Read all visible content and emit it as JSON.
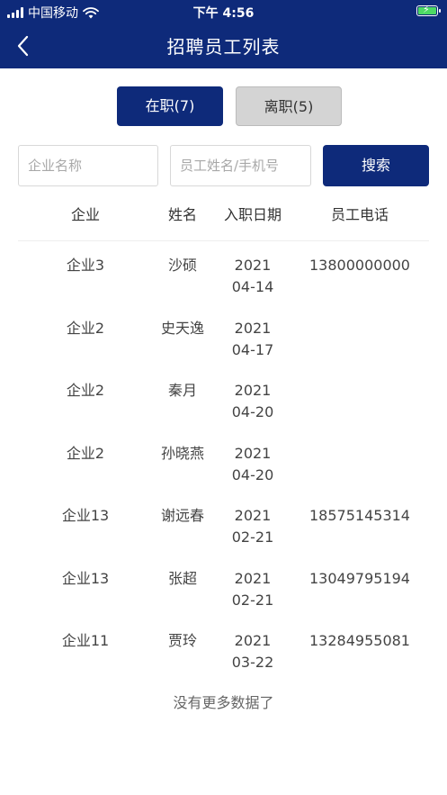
{
  "status_bar": {
    "carrier": "中国移动",
    "time": "下午 4:56"
  },
  "nav": {
    "title": "招聘员工列表"
  },
  "tabs": [
    {
      "label": "在职(7)",
      "active": true
    },
    {
      "label": "离职(5)",
      "active": false
    }
  ],
  "search": {
    "company_placeholder": "企业名称",
    "staff_placeholder": "员工姓名/手机号",
    "button_label": "搜索"
  },
  "table": {
    "headers": [
      "企业",
      "姓名",
      "入职日期",
      "员工电话"
    ],
    "rows": [
      {
        "company": "企业3",
        "name": "沙硕",
        "date_year": "2021",
        "date_md": "04-14",
        "phone": "13800000000"
      },
      {
        "company": "企业2",
        "name": "史天逸",
        "date_year": "2021",
        "date_md": "04-17",
        "phone": ""
      },
      {
        "company": "企业2",
        "name": "秦月",
        "date_year": "2021",
        "date_md": "04-20",
        "phone": ""
      },
      {
        "company": "企业2",
        "name": "孙晓燕",
        "date_year": "2021",
        "date_md": "04-20",
        "phone": ""
      },
      {
        "company": "企业13",
        "name": "谢远春",
        "date_year": "2021",
        "date_md": "02-21",
        "phone": "18575145314"
      },
      {
        "company": "企业13",
        "name": "张超",
        "date_year": "2021",
        "date_md": "02-21",
        "phone": "13049795194"
      },
      {
        "company": "企业11",
        "name": "贾玲",
        "date_year": "2021",
        "date_md": "03-22",
        "phone": "13284955081"
      }
    ]
  },
  "footer": {
    "no_more": "没有更多数据了"
  },
  "colors": {
    "primary": "#0e2a7a",
    "inactive_tab": "#d4d4d4",
    "battery": "#4cd964"
  },
  "icons": {
    "back": "chevron-left-icon",
    "signal": "signal-icon",
    "wifi": "wifi-icon",
    "battery": "battery-charging-icon"
  }
}
